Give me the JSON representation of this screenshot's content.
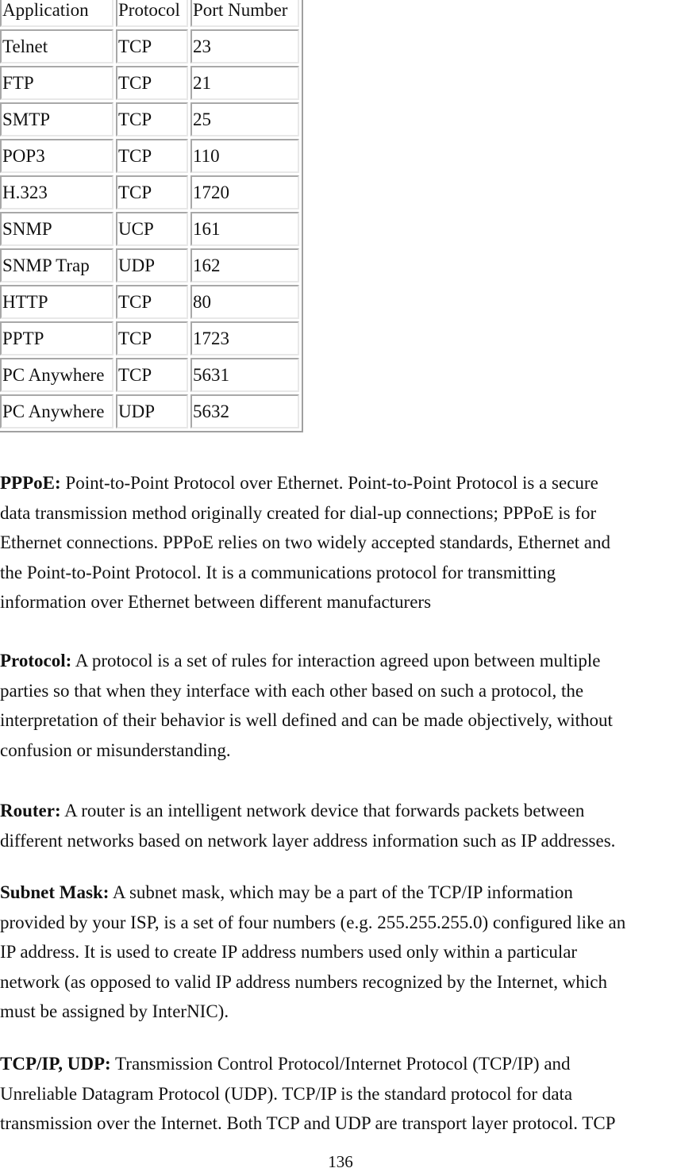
{
  "port_table": {
    "headers": [
      "Application",
      "Protocol",
      "Port Number"
    ],
    "rows": [
      [
        "Telnet",
        "TCP",
        "23"
      ],
      [
        "FTP",
        "TCP",
        "21"
      ],
      [
        "SMTP",
        "TCP",
        "25"
      ],
      [
        "POP3",
        "TCP",
        "110"
      ],
      [
        "H.323",
        "TCP",
        "1720"
      ],
      [
        "SNMP",
        "UCP",
        "161"
      ],
      [
        "SNMP Trap",
        "UDP",
        "162"
      ],
      [
        "HTTP",
        "TCP",
        "80"
      ],
      [
        "PPTP",
        "TCP",
        "1723"
      ],
      [
        "PC Anywhere",
        "TCP",
        "5631"
      ],
      [
        "PC Anywhere",
        "UDP",
        "5632"
      ]
    ]
  },
  "glossary": [
    {
      "term": "PPPoE:",
      "lines": [
        " Point-to-Point Protocol over Ethernet. Point-to-Point Protocol is a secure",
        "data transmission method originally created for dial-up connections; PPPoE is for",
        "Ethernet connections. PPPoE relies on two widely accepted standards, Ethernet and",
        "the Point-to-Point Protocol. It is a communications protocol for transmitting",
        "information over Ethernet between different manufacturers"
      ]
    },
    {
      "term": "Protocol:",
      "lines": [
        " A protocol is a set of rules for interaction agreed upon between multiple",
        "parties so that when they interface with each other based on such a protocol, the",
        "interpretation of their behavior is well defined and can be made objectively, without",
        "confusion or misunderstanding."
      ]
    },
    {
      "term": "Router:",
      "lines": [
        " A router is an intelligent network device that forwards packets between",
        "different networks based on network layer address information such as IP addresses."
      ]
    },
    {
      "term": "Subnet Mask:",
      "lines": [
        " A subnet mask, which may be a part of the TCP/IP information",
        "provided by your ISP, is a set of four numbers (e.g. 255.255.255.0) configured like an",
        "IP address. It is used to create IP address numbers used only within a particular",
        "network (as opposed to valid IP address numbers recognized by the Internet, which",
        "must be assigned by InterNIC)."
      ]
    },
    {
      "term": "TCP/IP, UDP:",
      "lines": [
        " Transmission Control Protocol/Internet Protocol (TCP/IP) and",
        "Unreliable Datagram Protocol (UDP). TCP/IP is the standard protocol for data",
        "transmission over the Internet. Both TCP and UDP are transport layer protocol. TCP"
      ]
    }
  ],
  "page_number": "136"
}
